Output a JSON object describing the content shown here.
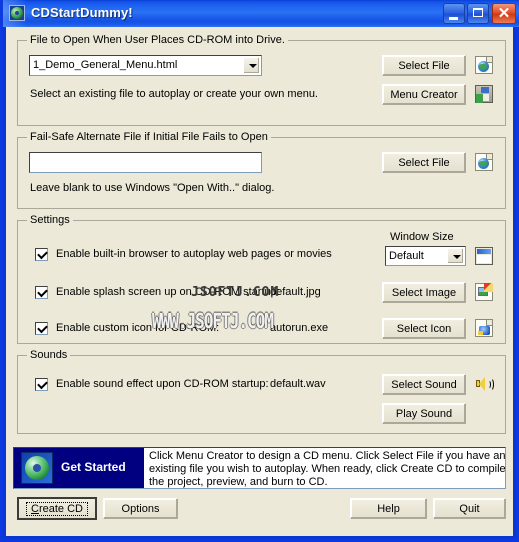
{
  "window": {
    "title": "CDStartDummy!",
    "app_icon": "cd-disc-icon",
    "caption_buttons": {
      "minimize": "minimize-icon",
      "maximize": "maximize-icon",
      "close": "✕"
    }
  },
  "group_file_open": {
    "legend": "File to Open When User Places CD-ROM into Drive.",
    "combo_value": "1_Demo_General_Menu.html",
    "hint": "Select an existing file to autoplay or create your own menu.",
    "select_file_label": "Select File",
    "menu_creator_label": "Menu Creator",
    "icon_select_file": "web-page-icon",
    "icon_menu_creator": "floppy-save-icon"
  },
  "group_failsafe": {
    "legend": "Fail-Safe Alternate File if Initial File Fails to Open",
    "input_value": "",
    "input_placeholder": "",
    "hint": "Leave blank to use Windows \"Open With..\" dialog.",
    "select_file_label": "Select File",
    "icon_select_file": "web-page-icon"
  },
  "group_settings": {
    "legend": "Settings",
    "window_size_label": "Window Size",
    "window_size_value": "Default",
    "icon_window_size": "window-preview-icon",
    "rows": [
      {
        "checked": true,
        "label": "Enable built-in browser to autoplay web pages or movies",
        "value": "",
        "button": "",
        "icon": ""
      },
      {
        "checked": true,
        "label": "Enable splash screen up on CD-ROM startup:",
        "value": "default.jpg",
        "button": "Select Image",
        "icon": "image-edit-icon"
      },
      {
        "checked": true,
        "label": "Enable custom icon for CD-ROM:",
        "value": "autorun.exe",
        "button": "Select Icon",
        "icon": "exe-file-icon"
      }
    ]
  },
  "group_sounds": {
    "legend": "Sounds",
    "checked": true,
    "label": "Enable sound effect upon CD-ROM startup:",
    "value": "default.wav",
    "select_sound_label": "Select Sound",
    "play_sound_label": "Play Sound",
    "icon_speaker": "speaker-icon"
  },
  "banner": {
    "icon": "cd-disc-icon",
    "title": "Get Started",
    "lines": [
      "Click Menu Creator to design a CD menu. Click Select File if you have an",
      "existing file you wish to autoplay. When ready, click Create CD to compile",
      "the project, preview, and burn to CD."
    ]
  },
  "footer": {
    "create_cd": {
      "prefix": "",
      "accel": "C",
      "suffix": "reate CD"
    },
    "options_label": "Options",
    "help_label": "Help",
    "quit_label": "Quit"
  },
  "watermarks": {
    "line1": "JSOFTJ.COM",
    "line2": "WWW.JSOFTJ.COM"
  },
  "colors": {
    "face": "#ece9d8",
    "title_blue": "#2b72f4",
    "banner_navy": "#000080",
    "border_blue": "#0c3ae0",
    "close_red": "#cf3a16"
  }
}
